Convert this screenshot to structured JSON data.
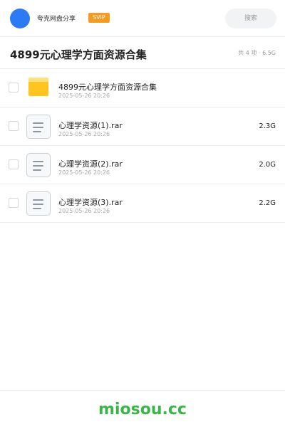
{
  "header": {
    "site_name": "夸克网盘分享",
    "badge": "SVIP",
    "search_label": "搜索"
  },
  "share": {
    "title": "4899元心理学方面资源合集",
    "summary": "共 4 项 · 6.5G"
  },
  "items": [
    {
      "type": "folder",
      "icon": "folder-icon",
      "name": "4899元心理学方面资源合集",
      "date": "2025-05-26 20:26",
      "size": ""
    },
    {
      "type": "file",
      "icon": "file-icon",
      "name": "心理学资源(1).rar",
      "date": "2025-05-26 20:26",
      "size": "2.3G"
    },
    {
      "type": "file",
      "icon": "file-icon",
      "name": "心理学资源(2).rar",
      "date": "2025-05-26 20:26",
      "size": "2.0G"
    },
    {
      "type": "file",
      "icon": "file-icon",
      "name": "心理学资源(3).rar",
      "date": "2025-05-26 20:26",
      "size": "2.2G"
    }
  ],
  "footer": {
    "watermark": "miosou.cc"
  },
  "colors": {
    "accent": "#2d7af5",
    "badge": "#f59a23",
    "folder": "#ffc41f",
    "watermark": "#3bb54a"
  }
}
